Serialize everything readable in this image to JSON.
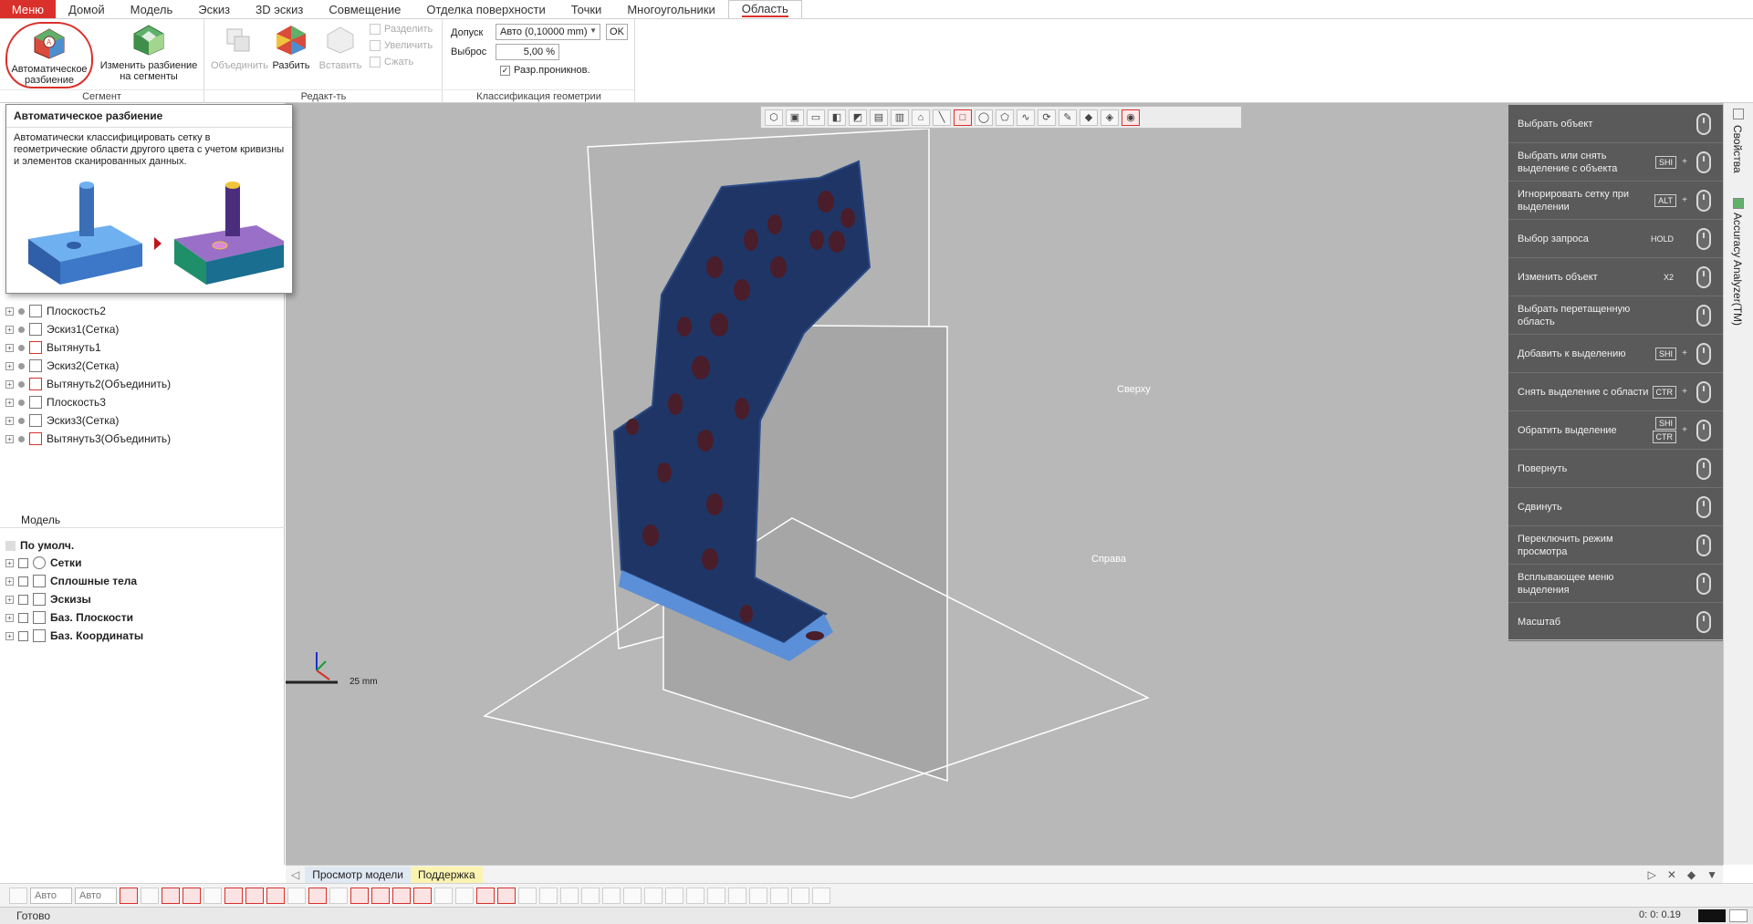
{
  "menubar": {
    "menu_label": "Меню",
    "tabs": [
      "Домой",
      "Модель",
      "Эскиз",
      "3D эскиз",
      "Совмещение",
      "Отделка поверхности",
      "Точки",
      "Многоугольники"
    ],
    "active_tab": "Область"
  },
  "ribbon": {
    "auto_split": "Автоматическое разбиение",
    "change_split": "Изменить разбиение на сегменты",
    "group_segment": "Сегмент",
    "merge": "Объединить",
    "split": "Разбить",
    "insert": "Вставить",
    "divide": "Разделить",
    "enlarge": "Увеличить",
    "shrink": "Сжать",
    "group_edit": "Редакт-ть",
    "tolerance_label": "Допуск",
    "tolerance_value": "Авто (0,10000 mm)",
    "ok": "OK",
    "outlier_label": "Выброс",
    "outlier_value": "5,00 %",
    "penetration_label": "Разр.проникнов.",
    "group_geom": "Классификация геометрии"
  },
  "tooltip": {
    "title": "Автоматическое разбиение",
    "desc": "Автоматически классифицировать сетку в геометрические области другого цвета с учетом кривизны и элементов сканированных данных."
  },
  "feature_tree": [
    {
      "label": "Плоскость2",
      "icon": "plane-icon"
    },
    {
      "label": "Эскиз1(Сетка)",
      "icon": "sketch-icon"
    },
    {
      "label": "Вытянуть1",
      "icon": "extrude-icon"
    },
    {
      "label": "Эскиз2(Сетка)",
      "icon": "sketch-icon"
    },
    {
      "label": "Вытянуть2(Объединить)",
      "icon": "extrude-icon"
    },
    {
      "label": "Плоскость3",
      "icon": "plane-icon"
    },
    {
      "label": "Эскиз3(Сетка)",
      "icon": "sketch-icon"
    },
    {
      "label": "Вытянуть3(Объединить)",
      "icon": "extrude-icon"
    }
  ],
  "model_tree": {
    "header": "Модель",
    "default": "По умолч.",
    "items": [
      {
        "label": "Сетки",
        "icon": "mesh-icon"
      },
      {
        "label": "Сплошные тела",
        "icon": "solid-icon"
      },
      {
        "label": "Эскизы",
        "icon": "sketch-icon"
      },
      {
        "label": "Баз. Плоскости",
        "icon": "plane-icon"
      },
      {
        "label": "Баз. Координаты",
        "icon": "coordinate-icon"
      }
    ]
  },
  "viewport": {
    "plane_front": "Сверху",
    "plane_right": "Справа",
    "scale_label": "25 mm"
  },
  "mouse_help": [
    {
      "label": "Выбрать объект",
      "keys": []
    },
    {
      "label": "Выбрать или снять выделение с объекта",
      "keys": [
        "SHI"
      ]
    },
    {
      "label": "Игнорировать сетку при выделении",
      "keys": [
        "ALT"
      ]
    },
    {
      "label": "Выбор запроса",
      "keys": [],
      "plain": "HOLD"
    },
    {
      "label": "Изменить объект",
      "keys": [],
      "plain": "X2"
    },
    {
      "label": "Выбрать перетащенную область",
      "keys": []
    },
    {
      "label": "Добавить к выделению",
      "keys": [
        "SHI"
      ]
    },
    {
      "label": "Снять выделение с области",
      "keys": [
        "CTR"
      ]
    },
    {
      "label": "Обратить выделение",
      "keys": [
        "SHI",
        "CTR"
      ]
    },
    {
      "label": "Повернуть",
      "keys": []
    },
    {
      "label": "Сдвинуть",
      "keys": []
    },
    {
      "label": "Переключить режим просмотра",
      "keys": []
    },
    {
      "label": "Всплывающее меню выделения",
      "keys": []
    },
    {
      "label": "Масштаб",
      "keys": []
    }
  ],
  "right_strip": {
    "properties": "Свойства",
    "accuracy": "Accuracy Analyzer(TM)"
  },
  "bottom_tabs": {
    "model_view": "Просмотр модели",
    "support": "Поддержка"
  },
  "bottom_toolbar": {
    "auto1": "Авто",
    "auto2": "Авто"
  },
  "status": {
    "ready": "Готово",
    "time": "0: 0: 0.19"
  }
}
